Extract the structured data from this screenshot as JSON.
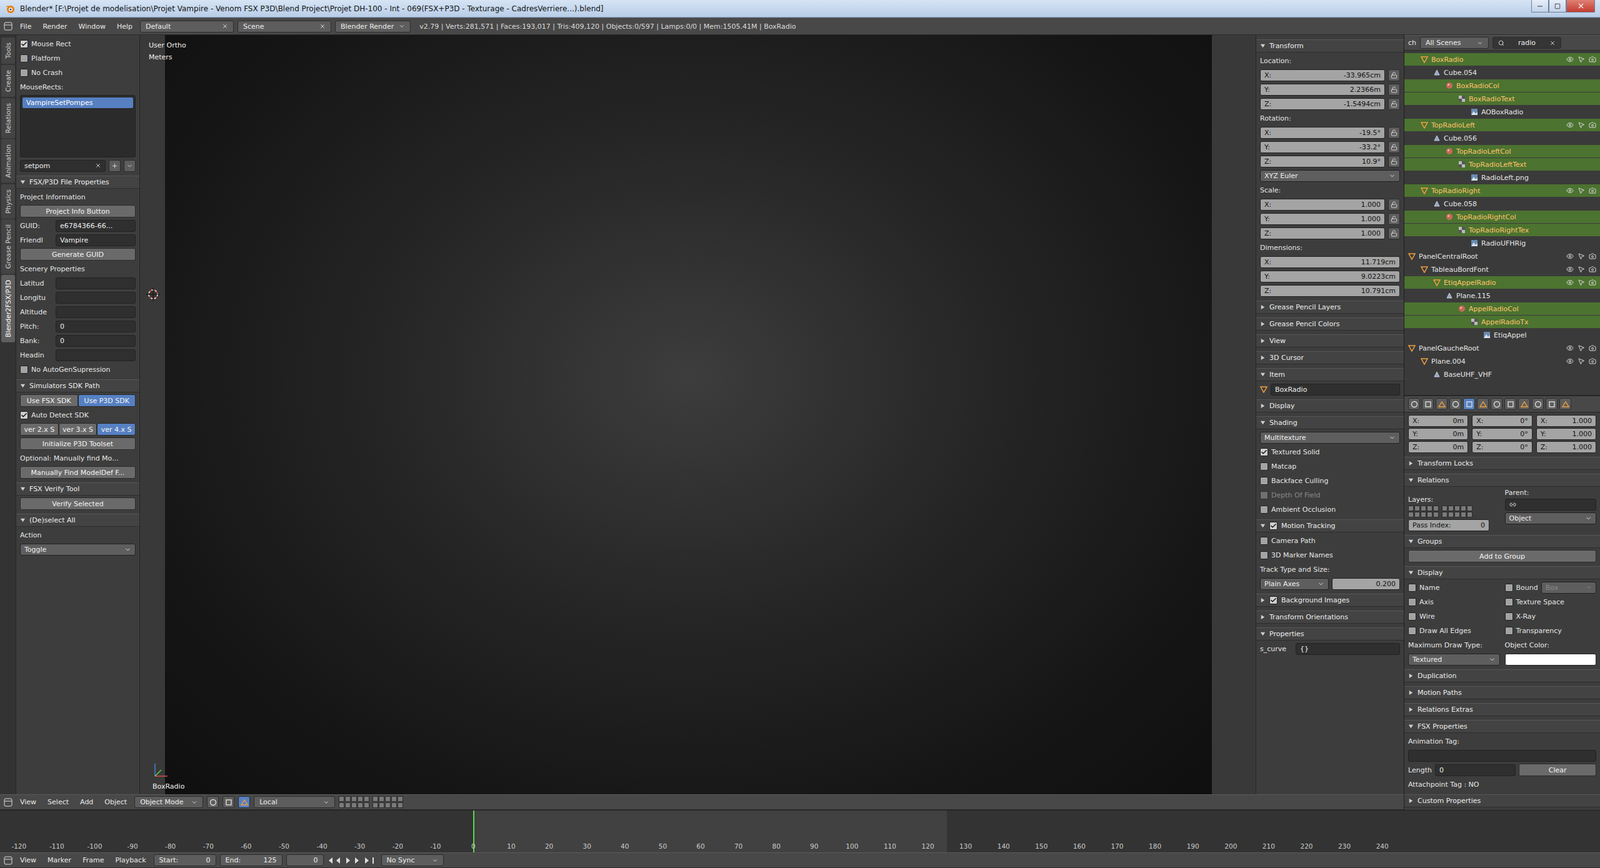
{
  "window": {
    "title": "Blender* [F:\\Projet de modelisation\\Projet Vampire - Venom FSX P3D\\Blend Project\\Projet DH-100 - Int - 069(FSX+P3D - Texturage - CadresVerriere...).blend]"
  },
  "info_header": {
    "menus": [
      "File",
      "Render",
      "Window",
      "Help"
    ],
    "layout": "Default",
    "scene": "Scene",
    "engine": "Blender Render",
    "stats": "v2.79 | Verts:281,571 | Faces:193,017 | Tris:409,120 | Objects:0/597 | Lamps:0/0 | Mem:1505.41M | BoxRadio"
  },
  "tool_shelf": {
    "tabs": [
      {
        "label": "Tools",
        "selected": false
      },
      {
        "label": "Create",
        "selected": false
      },
      {
        "label": "Relations",
        "selected": false
      },
      {
        "label": "Animation",
        "selected": false
      },
      {
        "label": "Physics",
        "selected": false
      },
      {
        "label": "Grease Pencil",
        "selected": false
      },
      {
        "label": "Blender2FSX/P3D",
        "selected": true
      }
    ],
    "rows": [
      {
        "kind": "checkbox",
        "label": "Mouse Rect",
        "checked": true,
        "disabled": false
      },
      {
        "kind": "checkbox",
        "label": "Platform",
        "checked": false,
        "disabled": false
      },
      {
        "kind": "checkbox",
        "label": "No Crash",
        "checked": false,
        "disabled": false
      },
      {
        "kind": "label",
        "text": "MouseRects:"
      },
      {
        "kind": "list",
        "items": [
          {
            "label": "VampireSetPompes",
            "selected": true
          }
        ]
      },
      {
        "kind": "name-field",
        "value": "setpom"
      },
      {
        "kind": "panel",
        "label": "FSX/P3D File Properties",
        "expanded": true
      },
      {
        "kind": "label",
        "text": "Project Information"
      },
      {
        "kind": "button",
        "label": "Project Info Button"
      },
      {
        "kind": "prop",
        "label": "GUID:",
        "value": "e6784366-66..."
      },
      {
        "kind": "prop",
        "label": "Friendl",
        "value": "Vampire"
      },
      {
        "kind": "button",
        "label": "Generate GUID"
      },
      {
        "kind": "label",
        "text": "Scenery Properties"
      },
      {
        "kind": "prop",
        "label": "Latitud",
        "value": ""
      },
      {
        "kind": "prop",
        "label": "Longitu",
        "value": ""
      },
      {
        "kind": "prop",
        "label": "Altitude",
        "value": ""
      },
      {
        "kind": "prop",
        "label": "Pitch:",
        "value": "0"
      },
      {
        "kind": "prop",
        "label": "Bank:",
        "value": "0"
      },
      {
        "kind": "prop",
        "label": "Headin",
        "value": ""
      },
      {
        "kind": "checkbox",
        "label": "No AutoGenSupression",
        "checked": false,
        "disabled": false
      },
      {
        "kind": "panel",
        "label": "Simulators SDK Path",
        "expanded": true
      },
      {
        "kind": "toggles",
        "options": [
          {
            "label": "Use FSX SDK",
            "selected": false
          },
          {
            "label": "Use P3D SDK",
            "selected": true
          }
        ]
      },
      {
        "kind": "checkbox",
        "label": "Auto Detect SDK",
        "checked": true,
        "disabled": false
      },
      {
        "kind": "toggles",
        "options": [
          {
            "label": "ver 2.x S",
            "selected": false
          },
          {
            "label": "ver 3.x S",
            "selected": false
          },
          {
            "label": "ver 4.x S",
            "selected": true
          }
        ]
      },
      {
        "kind": "button",
        "label": "Initialize P3D Toolset"
      },
      {
        "kind": "label",
        "text": "Optional: Manually find Mo..."
      },
      {
        "kind": "button",
        "label": "Manually Find ModelDef F..."
      },
      {
        "kind": "panel",
        "label": "FSX Verify Tool",
        "expanded": true
      },
      {
        "kind": "button",
        "label": "Verify Selected"
      },
      {
        "kind": "panel",
        "label": "(De)select All",
        "expanded": true
      },
      {
        "kind": "label",
        "text": "Action"
      },
      {
        "kind": "dropdown",
        "value": "Toggle"
      }
    ]
  },
  "viewport": {
    "view_name": "User Ortho",
    "units": "Meters",
    "object_name": "BoxRadio"
  },
  "n_panel": {
    "rows": [
      {
        "kind": "panel",
        "label": "Transform",
        "expanded": true
      },
      {
        "kind": "label",
        "text": "Location:"
      },
      {
        "kind": "vec",
        "axis": "X:",
        "value": "-33.965cm",
        "locked": false
      },
      {
        "kind": "vec",
        "axis": "Y:",
        "value": "2.2366m",
        "locked": false
      },
      {
        "kind": "vec",
        "axis": "Z:",
        "value": "-1.5494cm",
        "locked": false
      },
      {
        "kind": "label",
        "text": "Rotation:"
      },
      {
        "kind": "vec",
        "axis": "X:",
        "value": "-19.5°",
        "locked": false
      },
      {
        "kind": "vec",
        "axis": "Y:",
        "value": "-33.2°",
        "locked": false
      },
      {
        "kind": "vec",
        "axis": "Z:",
        "value": "10.9°",
        "locked": false
      },
      {
        "kind": "dropdown",
        "value": "XYZ Euler"
      },
      {
        "kind": "label",
        "text": "Scale:"
      },
      {
        "kind": "vec",
        "axis": "X:",
        "value": "1.000",
        "locked": false
      },
      {
        "kind": "vec",
        "axis": "Y:",
        "value": "1.000",
        "locked": false
      },
      {
        "kind": "vec",
        "axis": "Z:",
        "value": "1.000",
        "locked": false
      },
      {
        "kind": "label",
        "text": "Dimensions:"
      },
      {
        "kind": "dim",
        "axis": "X:",
        "value": "11.719cm"
      },
      {
        "kind": "dim",
        "axis": "Y:",
        "value": "9.0223cm"
      },
      {
        "kind": "dim",
        "axis": "Z:",
        "value": "10.791cm"
      },
      {
        "kind": "panel",
        "label": "Grease Pencil Layers",
        "expanded": false
      },
      {
        "kind": "panel",
        "label": "Grease Pencil Colors",
        "expanded": false
      },
      {
        "kind": "panel",
        "label": "View",
        "expanded": false
      },
      {
        "kind": "panel",
        "label": "3D Cursor",
        "expanded": false
      },
      {
        "kind": "panel",
        "label": "Item",
        "expanded": true
      },
      {
        "kind": "name",
        "value": "BoxRadio"
      },
      {
        "kind": "panel",
        "label": "Display",
        "expanded": false
      },
      {
        "kind": "panel",
        "label": "Shading",
        "expanded": true
      },
      {
        "kind": "dropdown",
        "value": "Multitexture"
      },
      {
        "kind": "checkbox",
        "label": "Textured Solid",
        "checked": true,
        "disabled": false
      },
      {
        "kind": "checkbox",
        "label": "Matcap",
        "checked": false,
        "disabled": false
      },
      {
        "kind": "checkbox",
        "label": "Backface Culling",
        "checked": false,
        "disabled": false
      },
      {
        "kind": "checkbox",
        "label": "Depth Of Field",
        "checked": false,
        "disabled": true
      },
      {
        "kind": "checkbox",
        "label": "Ambient Occlusion",
        "checked": false,
        "disabled": false
      },
      {
        "kind": "panel",
        "label": "Motion Tracking",
        "expanded": true,
        "checked": true
      },
      {
        "kind": "checkbox",
        "label": "Camera Path",
        "checked": false,
        "disabled": false
      },
      {
        "kind": "checkbox",
        "label": "3D Marker Names",
        "checked": false,
        "disabled": false
      },
      {
        "kind": "label",
        "text": "Track Type and Size:"
      },
      {
        "kind": "split",
        "left": "Plain Axes",
        "right": "0.200"
      },
      {
        "kind": "panel",
        "label": "Background Images",
        "expanded": false,
        "checked": true
      },
      {
        "kind": "panel",
        "label": "Transform Orientations",
        "expanded": false
      },
      {
        "kind": "panel",
        "label": "Properties",
        "expanded": true
      },
      {
        "kind": "prop",
        "label": "s_curve",
        "value": "{}"
      }
    ]
  },
  "outliner": {
    "header_text": "ch",
    "scope": "All Scenes",
    "search": "radio",
    "rows": [
      {
        "label": "BoxRadio",
        "depth": 1,
        "kind": "object",
        "highlighted": true
      },
      {
        "label": "Cube.054",
        "depth": 2,
        "kind": "mesh",
        "highlighted": false
      },
      {
        "label": "BoxRadioCol",
        "depth": 3,
        "kind": "material",
        "highlighted": true
      },
      {
        "label": "BoxRadioText",
        "depth": 4,
        "kind": "texture",
        "highlighted": true
      },
      {
        "label": "AOBoxRadio",
        "depth": 5,
        "kind": "image",
        "highlighted": false
      },
      {
        "label": "TopRadioLeft",
        "depth": 1,
        "kind": "object",
        "highlighted": true
      },
      {
        "label": "Cube.056",
        "depth": 2,
        "kind": "mesh",
        "highlighted": false
      },
      {
        "label": "TopRadioLeftCol",
        "depth": 3,
        "kind": "material",
        "highlighted": true
      },
      {
        "label": "TopRadioLeftText",
        "depth": 4,
        "kind": "texture",
        "highlighted": true
      },
      {
        "label": "RadioLeft.png",
        "depth": 5,
        "kind": "image",
        "highlighted": false
      },
      {
        "label": "TopRadioRight",
        "depth": 1,
        "kind": "object",
        "highlighted": true
      },
      {
        "label": "Cube.058",
        "depth": 2,
        "kind": "mesh",
        "highlighted": false
      },
      {
        "label": "TopRadioRightCol",
        "depth": 3,
        "kind": "material",
        "highlighted": true
      },
      {
        "label": "TopRadioRightTex",
        "depth": 4,
        "kind": "texture",
        "highlighted": true
      },
      {
        "label": "RadioUFHRig",
        "depth": 5,
        "kind": "image",
        "highlighted": false
      },
      {
        "label": "PanelCentralRoot",
        "depth": 0,
        "kind": "object",
        "highlighted": false
      },
      {
        "label": "TableauBordFont",
        "depth": 1,
        "kind": "object",
        "highlighted": false
      },
      {
        "label": "EtiqAppelRadio",
        "depth": 2,
        "kind": "object",
        "highlighted": true
      },
      {
        "label": "Plane.115",
        "depth": 3,
        "kind": "mesh",
        "highlighted": false
      },
      {
        "label": "AppelRadioCol",
        "depth": 4,
        "kind": "material",
        "highlighted": true
      },
      {
        "label": "AppelRadioTx",
        "depth": 5,
        "kind": "texture",
        "highlighted": true
      },
      {
        "label": "EtiqAppel",
        "depth": 6,
        "kind": "image",
        "highlighted": false
      },
      {
        "label": "PanelGaucheRoot",
        "depth": 0,
        "kind": "object",
        "highlighted": false
      },
      {
        "label": "Plane.004",
        "depth": 1,
        "kind": "object",
        "highlighted": false
      },
      {
        "label": "BaseUHF_VHF",
        "depth": 2,
        "kind": "mesh",
        "highlighted": false
      }
    ]
  },
  "properties": {
    "tabs": [
      {
        "selected": false
      },
      {
        "selected": false
      },
      {
        "selected": false
      },
      {
        "selected": false
      },
      {
        "selected": true
      },
      {
        "selected": false
      },
      {
        "selected": false
      },
      {
        "selected": false
      },
      {
        "selected": false
      },
      {
        "selected": false
      },
      {
        "selected": false
      },
      {
        "selected": false
      }
    ],
    "coords": [
      [
        {
          "axis": "X:",
          "value": "0m"
        },
        {
          "axis": "X:",
          "value": "0°"
        },
        {
          "axis": "X:",
          "value": "1.000"
        }
      ],
      [
        {
          "axis": "Y:",
          "value": "0m"
        },
        {
          "axis": "Y:",
          "value": "0°"
        },
        {
          "axis": "Y:",
          "value": "1.000"
        }
      ],
      [
        {
          "axis": "Z:",
          "value": "0m"
        },
        {
          "axis": "Z:",
          "value": "0°"
        },
        {
          "axis": "Z:",
          "value": "1.000"
        }
      ]
    ],
    "rows": [
      {
        "kind": "panel",
        "label": "Transform Locks",
        "expanded": false
      },
      {
        "kind": "panel",
        "label": "Relations",
        "expanded": true
      },
      {
        "kind": "relations",
        "layers_label": "Layers:",
        "parent_label": "Parent:",
        "parent_type": "Object"
      },
      {
        "kind": "field",
        "label": "Pass Index:",
        "value": "0"
      },
      {
        "kind": "panel",
        "label": "Groups",
        "expanded": true
      },
      {
        "kind": "button",
        "label": "Add to Group"
      },
      {
        "kind": "panel",
        "label": "Display",
        "expanded": true
      },
      {
        "kind": "check-pair",
        "items": [
          {
            "label": "Name",
            "checked": false
          },
          {
            "label": "Bound",
            "checked": false
          }
        ],
        "dropdown": {
          "value": "Box",
          "disabled": true
        }
      },
      {
        "kind": "check-pair",
        "items": [
          {
            "label": "Axis",
            "checked": false
          },
          {
            "label": "Texture Space",
            "checked": false
          }
        ]
      },
      {
        "kind": "check-pair",
        "items": [
          {
            "label": "Wire",
            "checked": false
          },
          {
            "label": "X-Ray",
            "checked": false
          }
        ]
      },
      {
        "kind": "check-pair",
        "items": [
          {
            "label": "Draw All Edges",
            "checked": false
          },
          {
            "label": "Transparency",
            "checked": false
          }
        ]
      },
      {
        "kind": "label-pair",
        "items": [
          "Maximum Draw Type:",
          "Object Color:"
        ]
      },
      {
        "kind": "draw-type",
        "value": "Textured"
      },
      {
        "kind": "panel",
        "label": "Duplication",
        "expanded": false
      },
      {
        "kind": "panel",
        "label": "Motion Paths",
        "expanded": false
      },
      {
        "kind": "panel",
        "label": "Relations Extras",
        "expanded": false
      },
      {
        "kind": "panel",
        "label": "FSX Properties",
        "expanded": true
      },
      {
        "kind": "label",
        "text": "Animation Tag:"
      },
      {
        "kind": "input",
        "value": ""
      },
      {
        "kind": "length",
        "label": "Length",
        "value": "0",
        "button": "Clear"
      },
      {
        "kind": "label",
        "text": "Attachpoint Tag : NO"
      },
      {
        "kind": "panel",
        "label": "Custom Properties",
        "expanded": false
      }
    ]
  },
  "viewport_header": {
    "menus": [
      "View",
      "Select",
      "Add",
      "Object"
    ],
    "mode": "Object Mode",
    "orientation": "Local"
  },
  "timeline": {
    "ticks": [
      "-120",
      "-110",
      "-100",
      "-90",
      "-80",
      "-70",
      "-60",
      "-50",
      "-40",
      "-30",
      "-20",
      "-10",
      "0",
      "10",
      "20",
      "30",
      "40",
      "50",
      "60",
      "70",
      "80",
      "90",
      "100",
      "110",
      "120",
      "130",
      "140",
      "150",
      "160",
      "170",
      "180",
      "190",
      "200",
      "210",
      "220",
      "230",
      "240"
    ],
    "current_frame": 0
  },
  "timeline_header": {
    "menus": [
      "View",
      "Marker",
      "Frame",
      "Playback"
    ],
    "start": {
      "label": "Start:",
      "value": "0"
    },
    "end": {
      "label": "End:",
      "value": "125"
    },
    "frame": "0",
    "sync": "No Sync"
  }
}
